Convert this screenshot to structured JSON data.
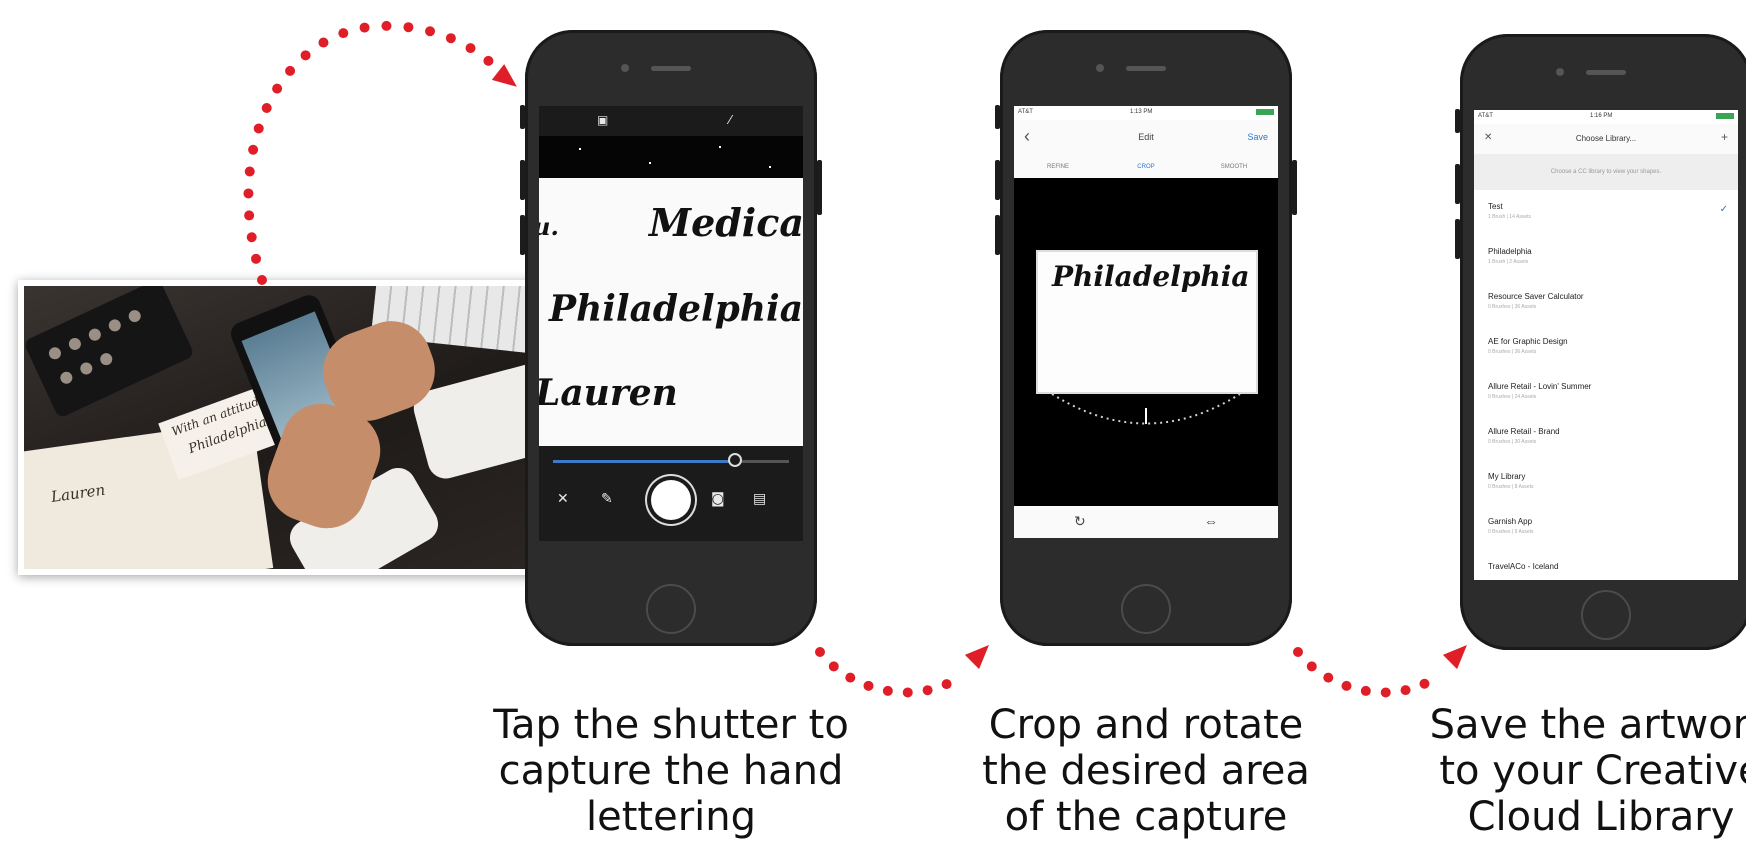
{
  "colors": {
    "arrow": "#e01e27",
    "accent_blue": "#2e77d0",
    "phone_body": "#2c2c2c"
  },
  "photo": {
    "scribbles": [
      "With an attitude",
      "Philadelphia",
      "Lauren"
    ]
  },
  "phone1": {
    "icons": [
      "square-icon",
      "wand-icon",
      "close-icon",
      "wrench-icon",
      "shutter-button",
      "camera-icon",
      "image-icon"
    ],
    "lettering": [
      "Medical",
      "Philadelphia",
      "Lauren",
      "u."
    ],
    "slider_position": 0.77
  },
  "phone2": {
    "status_left": "AT&T",
    "status_time": "1:13 PM",
    "back": "‹",
    "title": "Edit",
    "save": "Save",
    "tabs": [
      "REFINE",
      "CROP",
      "SMOOTH"
    ],
    "active_tab": "CROP",
    "crop_text": "Philadelphia",
    "bottom_icons": [
      "rotate-icon",
      "flip-icon"
    ]
  },
  "phone3": {
    "status_left": "AT&T",
    "status_time": "1:16 PM",
    "close": "✕",
    "title": "Choose Library...",
    "add": "+",
    "hint": "Choose a CC library to view your shapes.",
    "libraries": [
      {
        "name": "Test",
        "sub": "1 Brush | 14 Assets",
        "checked": true
      },
      {
        "name": "Philadelphia",
        "sub": "1 Brush | 2 Assets",
        "checked": false
      },
      {
        "name": "Resource Saver Calculator",
        "sub": "0 Brushes | 36 Assets",
        "checked": false
      },
      {
        "name": "AE for Graphic Design",
        "sub": "0 Brushes | 36 Assets",
        "checked": false
      },
      {
        "name": "Allure Retail - Lovin' Summer",
        "sub": "0 Brushes | 24 Assets",
        "checked": false
      },
      {
        "name": "Allure Retail - Brand",
        "sub": "0 Brushes | 30 Assets",
        "checked": false
      },
      {
        "name": "My Library",
        "sub": "0 Brushes | 8 Assets",
        "checked": false
      },
      {
        "name": "Garnish App",
        "sub": "0 Brushes | 9 Assets",
        "checked": false
      },
      {
        "name": "TravelACo - Iceland",
        "sub": "",
        "checked": false
      }
    ]
  },
  "captions": [
    {
      "lines": [
        "Tap the shutter to",
        "capture the hand",
        "lettering"
      ]
    },
    {
      "lines": [
        "Crop and rotate",
        "the desired area",
        "of the capture"
      ]
    },
    {
      "lines": [
        "Save the artwork",
        "to your Creative",
        "Cloud Library"
      ]
    }
  ]
}
